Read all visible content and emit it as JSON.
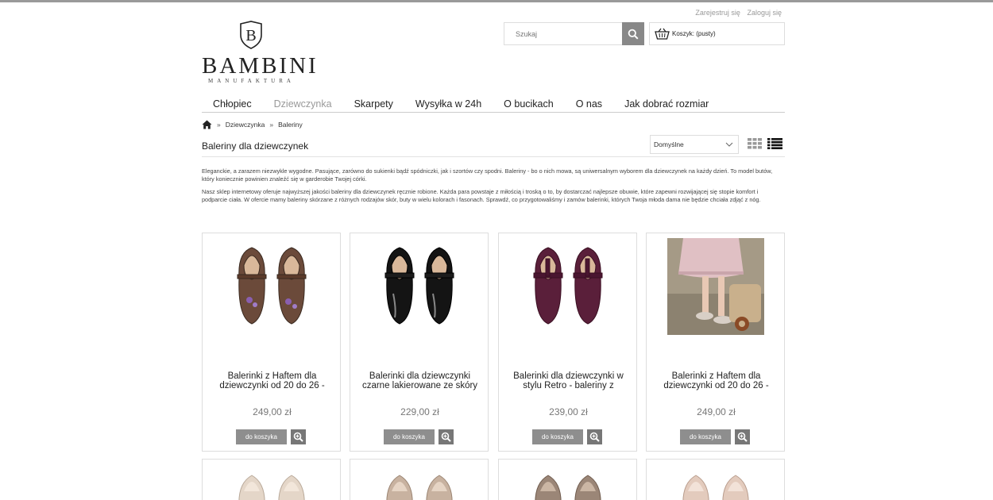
{
  "header": {
    "register_link": "Zarejestruj się",
    "login_link": "Zaloguj się",
    "logo_text": "BAMBINI",
    "logo_subtext": "MANUFAKTURA",
    "logo_monogram": "B",
    "search_placeholder": "Szukaj",
    "cart_label": "Koszyk: (pusty)"
  },
  "nav": {
    "items": [
      {
        "label": "Chłopiec"
      },
      {
        "label": "Dziewczynka",
        "active": true
      },
      {
        "label": "Skarpety"
      },
      {
        "label": "Wysyłka w 24h"
      },
      {
        "label": "O bucikach"
      },
      {
        "label": "O nas"
      },
      {
        "label": "Jak dobrać rozmiar"
      }
    ]
  },
  "breadcrumb": {
    "sep": "»",
    "items": [
      "Dziewczynka",
      "Baleriny"
    ]
  },
  "category": {
    "title": "Baleriny dla dziewczynek",
    "sort_selected": "Domyślne",
    "desc_p1": "Eleganckie, a zarazem niezwykle wygodne. Pasujące, zarówno do sukienki bądź spódniczki, jak i szortów czy spodni. Baleriny - bo o nich mowa, są uniwersalnym wyborem dla dziewczynek na każdy dzień. To model butów, który koniecznie powinien znaleźć się w garderobie Twojej córki.",
    "desc_p2": "Nasz sklep internetowy oferuje najwyższej jakości baleriny dla dziewczynek ręcznie robione. Każda para powstaje z miłością i troską o to, by dostarczać najlepsze obuwie, które zapewni rozwijającej się stopie komfort i podparcie ciała. W ofercie mamy baleriny skórzane z różnych rodzajów skór, buty w wielu kolorach i fasonach. Sprawdź, co przygotowaliśmy i zamów balerinki, których Twoja młoda dama nie będzie chciała zdjąć z nóg."
  },
  "products": [
    {
      "name": "Balerinki z Haftem dla dziewczynki od 20 do 26 -",
      "price": "249,00 zł",
      "add_label": "do koszyka",
      "color": "#6b4a3a",
      "image": "brown-tbar-shoes-embroidered"
    },
    {
      "name": "Balerinki dla dziewczynki czarne lakierowane ze skóry",
      "price": "229,00 zł",
      "add_label": "do koszyka",
      "color": "#141414",
      "image": "black-patent-tbar-shoes"
    },
    {
      "name": "Balerinki dla dziewczynki w stylu Retro - baleriny z",
      "price": "239,00 zł",
      "add_label": "do koszyka",
      "color": "#5a1f3a",
      "image": "plum-suede-tbar-shoes"
    },
    {
      "name": "Balerinki z Haftem dla dziewczynki od 20 do 26 -",
      "price": "249,00 zł",
      "add_label": "do koszyka",
      "color": "#d8b9b0",
      "image": "girl-wearing-shoes-photo"
    }
  ],
  "products_row2_colors": [
    "#e4d6c8",
    "#c8b2a0",
    "#9b8677",
    "#e3cbbd"
  ]
}
